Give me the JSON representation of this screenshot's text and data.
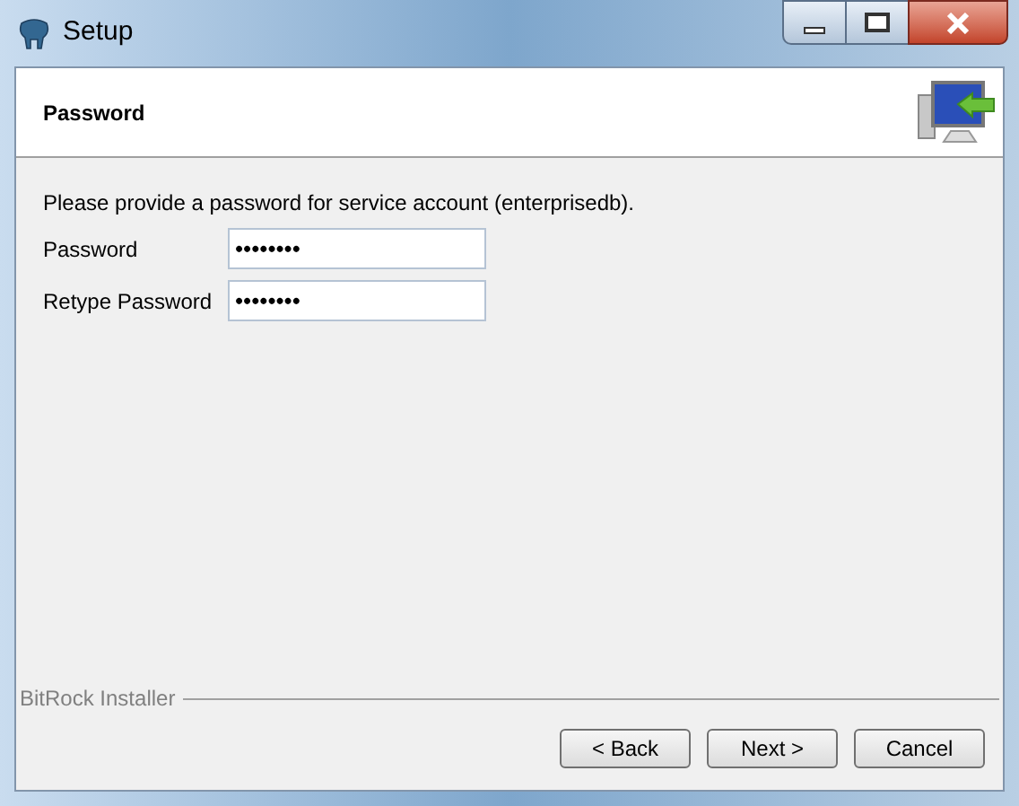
{
  "window": {
    "title": "Setup"
  },
  "header": {
    "title": "Password"
  },
  "intro": "Please provide a password for service account (enterprisedb).",
  "fields": [
    {
      "label": "Password",
      "value": "••••••••"
    },
    {
      "label": "Retype Password",
      "value": "••••••••"
    }
  ],
  "footer": {
    "brand": "BitRock Installer"
  },
  "buttons": [
    "< Back",
    "Next >",
    "Cancel"
  ]
}
